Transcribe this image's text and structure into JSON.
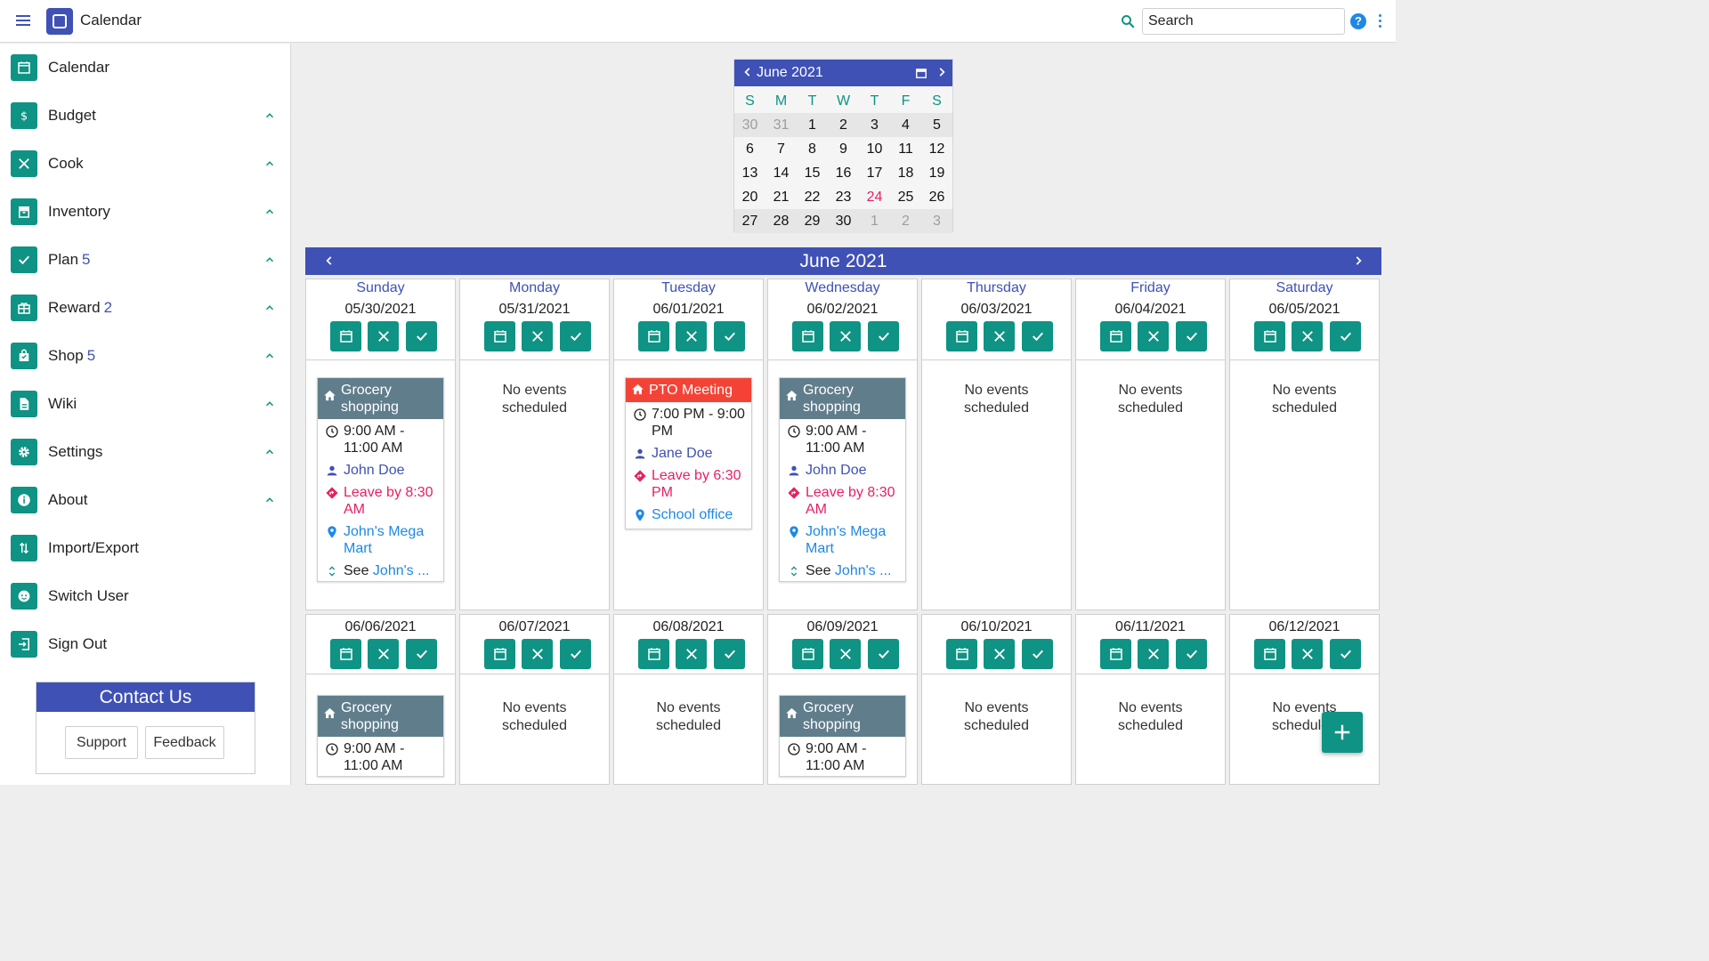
{
  "app": {
    "title": "Calendar"
  },
  "search": {
    "placeholder": "Search",
    "value": "Search"
  },
  "sidebar": {
    "items": [
      {
        "label": "Calendar",
        "count": ""
      },
      {
        "label": "Budget",
        "count": ""
      },
      {
        "label": "Cook",
        "count": ""
      },
      {
        "label": "Inventory",
        "count": ""
      },
      {
        "label": "Plan",
        "count": "5"
      },
      {
        "label": "Reward",
        "count": "2"
      },
      {
        "label": "Shop",
        "count": "5"
      },
      {
        "label": "Wiki",
        "count": ""
      },
      {
        "label": "Settings",
        "count": ""
      },
      {
        "label": "About",
        "count": ""
      },
      {
        "label": "Import/Export",
        "count": ""
      },
      {
        "label": "Switch User",
        "count": ""
      },
      {
        "label": "Sign Out",
        "count": ""
      }
    ]
  },
  "contact": {
    "title": "Contact Us",
    "support": "Support",
    "feedback": "Feedback"
  },
  "minical": {
    "title": "June 2021",
    "weekdays": [
      "S",
      "M",
      "T",
      "W",
      "T",
      "F",
      "S"
    ],
    "rows": [
      [
        "30",
        "31",
        "1",
        "2",
        "3",
        "4",
        "5"
      ],
      [
        "6",
        "7",
        "8",
        "9",
        "10",
        "11",
        "12"
      ],
      [
        "13",
        "14",
        "15",
        "16",
        "17",
        "18",
        "19"
      ],
      [
        "20",
        "21",
        "22",
        "23",
        "24",
        "25",
        "26"
      ],
      [
        "27",
        "28",
        "29",
        "30",
        "1",
        "2",
        "3"
      ]
    ],
    "today": "24"
  },
  "month": {
    "title": "June 2021"
  },
  "week1": [
    {
      "name": "Sunday",
      "date": "05/30/2021"
    },
    {
      "name": "Monday",
      "date": "05/31/2021"
    },
    {
      "name": "Tuesday",
      "date": "06/01/2021"
    },
    {
      "name": "Wednesday",
      "date": "06/02/2021"
    },
    {
      "name": "Thursday",
      "date": "06/03/2021"
    },
    {
      "name": "Friday",
      "date": "06/04/2021"
    },
    {
      "name": "Saturday",
      "date": "06/05/2021"
    }
  ],
  "week2": [
    {
      "date": "06/06/2021"
    },
    {
      "date": "06/07/2021"
    },
    {
      "date": "06/08/2021"
    },
    {
      "date": "06/09/2021"
    },
    {
      "date": "06/10/2021"
    },
    {
      "date": "06/11/2021"
    },
    {
      "date": "06/12/2021"
    }
  ],
  "no_events": "No events scheduled",
  "events": {
    "grocery": {
      "title": "Grocery shopping",
      "time": "9:00 AM - 11:00 AM",
      "person": "John Doe",
      "leave": "Leave by 8:30 AM",
      "location": "John's Mega Mart",
      "see_prefix": "See",
      "see_link": "John's ..."
    },
    "pto": {
      "title": "PTO Meeting",
      "time": "7:00 PM - 9:00 PM",
      "person": "Jane Doe",
      "leave": "Leave by 6:30 PM",
      "location": "School office"
    }
  },
  "colors": {
    "primary": "#3f51b5",
    "teal": "#0e9384",
    "accent": "#e91e63",
    "link": "#1e88e5",
    "event_gray": "#607d8b",
    "event_red": "#f44336"
  }
}
